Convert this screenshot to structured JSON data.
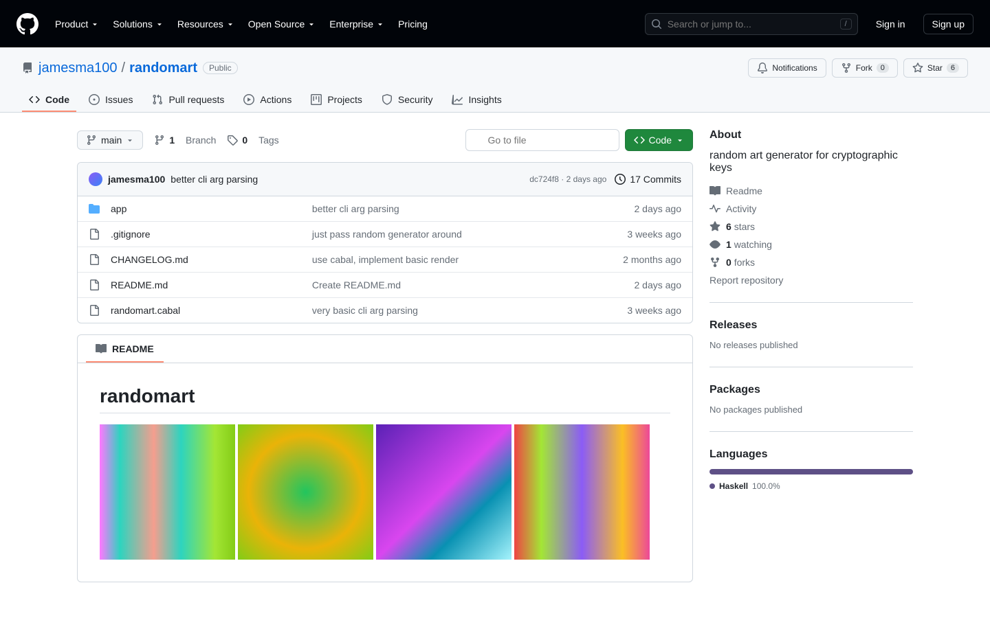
{
  "globalNav": {
    "items": [
      "Product",
      "Solutions",
      "Resources",
      "Open Source",
      "Enterprise",
      "Pricing"
    ],
    "searchPlaceholder": "Search or jump to...",
    "searchKey": "/",
    "signIn": "Sign in",
    "signUp": "Sign up"
  },
  "repo": {
    "owner": "jamesma100",
    "name": "randomart",
    "visibility": "Public",
    "actions": {
      "notifications": "Notifications",
      "fork": "Fork",
      "forkCount": "0",
      "star": "Star",
      "starCount": "6"
    }
  },
  "repoNav": [
    "Code",
    "Issues",
    "Pull requests",
    "Actions",
    "Projects",
    "Security",
    "Insights"
  ],
  "fileNav": {
    "branch": "main",
    "branchesCount": "1",
    "branchesLabel": "Branch",
    "tagsCount": "0",
    "tagsLabel": "Tags",
    "gotoFile": "Go to file",
    "codeButton": "Code"
  },
  "latestCommit": {
    "author": "jamesma100",
    "message": "better cli arg parsing",
    "sha": "dc724f8",
    "date": "2 days ago",
    "totalCommits": "17 Commits"
  },
  "files": [
    {
      "icon": "dir",
      "name": "app",
      "msg": "better cli arg parsing",
      "time": "2 days ago"
    },
    {
      "icon": "file",
      "name": ".gitignore",
      "msg": "just pass random generator around",
      "time": "3 weeks ago"
    },
    {
      "icon": "file",
      "name": "CHANGELOG.md",
      "msg": "use cabal, implement basic render",
      "time": "2 months ago"
    },
    {
      "icon": "file",
      "name": "README.md",
      "msg": "Create README.md",
      "time": "2 days ago"
    },
    {
      "icon": "file",
      "name": "randomart.cabal",
      "msg": "very basic cli arg parsing",
      "time": "3 weeks ago"
    }
  ],
  "readme": {
    "tabLabel": "README",
    "heading": "randomart"
  },
  "about": {
    "title": "About",
    "description": "random art generator for cryptographic keys",
    "links": {
      "readme": "Readme",
      "activity": "Activity",
      "starsCount": "6",
      "starsLabel": "stars",
      "watchingCount": "1",
      "watchingLabel": "watching",
      "forksCount": "0",
      "forksLabel": "forks",
      "report": "Report repository"
    }
  },
  "releases": {
    "title": "Releases",
    "empty": "No releases published"
  },
  "packages": {
    "title": "Packages",
    "empty": "No packages published"
  },
  "languages": {
    "title": "Languages",
    "lang": "Haskell",
    "pct": "100.0%"
  }
}
